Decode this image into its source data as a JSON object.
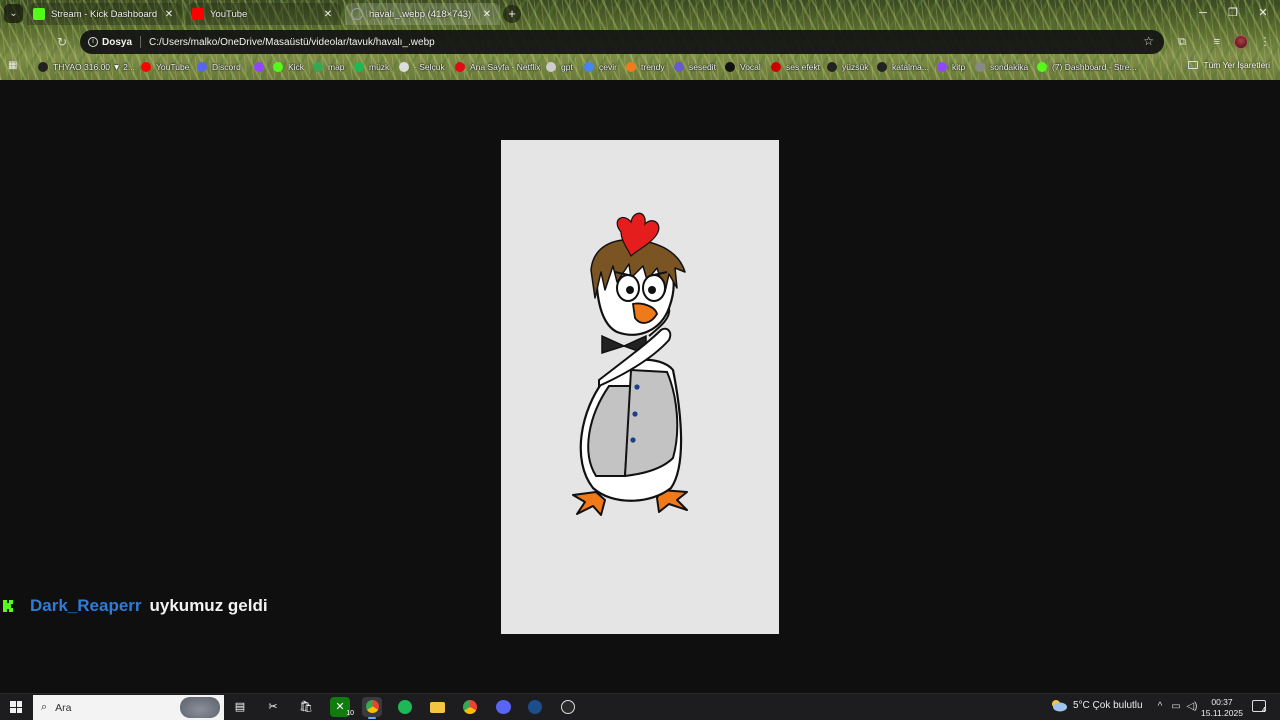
{
  "tabs": [
    {
      "title": "Stream - Kick Dashboard",
      "favicon_color": "#53fc18",
      "active": false
    },
    {
      "title": "YouTube",
      "favicon_color": "#ff0000",
      "active": false
    },
    {
      "title": "havalı_.webp (418×743)",
      "favicon_color": "#9aa0a6",
      "active": true
    }
  ],
  "omnibox": {
    "scheme_label": "Dosya",
    "url": "C:/Users/malko/OneDrive/Masaüstü/videolar/tavuk/havalı_.webp"
  },
  "bookmarks": [
    {
      "label": "THYAO 316.00 ▼ 2...",
      "color": "#222222"
    },
    {
      "label": "YouTube",
      "color": "#ff0000"
    },
    {
      "label": "Discord",
      "color": "#5865f2"
    },
    {
      "label": "",
      "color": "#9146ff"
    },
    {
      "label": "Kick",
      "color": "#53fc18"
    },
    {
      "label": "map",
      "color": "#34a853"
    },
    {
      "label": "müzk",
      "color": "#1db954"
    },
    {
      "label": "- Selçuk",
      "color": "#dddddd"
    },
    {
      "label": "Ana Sayfa - Netflix",
      "color": "#e50914"
    },
    {
      "label": "gpt",
      "color": "#cccccc"
    },
    {
      "label": "çevir",
      "color": "#4285f4"
    },
    {
      "label": "trendy",
      "color": "#f27a1a"
    },
    {
      "label": "sesedit",
      "color": "#6a5acd"
    },
    {
      "label": "Vocal",
      "color": "#111111"
    },
    {
      "label": "ses efekt",
      "color": "#cc0000"
    },
    {
      "label": "yüzsük",
      "color": "#222222"
    },
    {
      "label": "katalma...",
      "color": "#222222"
    },
    {
      "label": "kitp",
      "color": "#9146ff"
    },
    {
      "label": "sondakika",
      "color": "#888888"
    },
    {
      "label": "(7) Dashboard - Stre...",
      "color": "#53fc18"
    }
  ],
  "bookmarks_all_label": "Tüm Yer İşaretleri",
  "chat": {
    "username": "Dark_Reaperr",
    "message": "uykumuz geldi",
    "username_color": "#2f7bd6"
  },
  "taskbar": {
    "search_placeholder": "Ara",
    "xbox_badge": "10",
    "weather": "5°C  Çok bulutlu",
    "time": "00:37",
    "date": "15.11.2025",
    "notification_count": "4"
  }
}
